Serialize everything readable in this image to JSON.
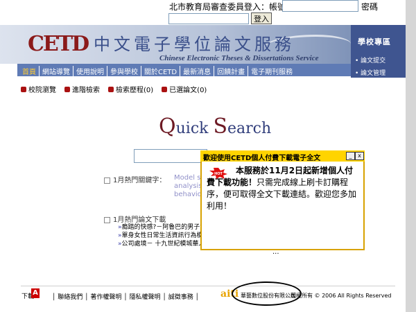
{
  "login": {
    "label": "北市教育局審查委員登入：帳號",
    "password_label": "密碼",
    "account_value": "",
    "password_value": "",
    "button": "登入"
  },
  "banner": {
    "logo": "CETD",
    "title_cn": "中文電子學位論文服務",
    "title_en": "Chinese Electronic Theses & Dissertations Service"
  },
  "school_zone": {
    "title": "學校專區",
    "links": [
      "• 論文提交",
      "• 論文管理"
    ]
  },
  "nav": {
    "items": [
      "首頁",
      "網站導覽",
      "使用說明",
      "參與學校",
      "關於CETD",
      "最新消息",
      "回饋計畫",
      "電子期刊服務"
    ]
  },
  "toolbar": {
    "items": [
      "校院瀏覽",
      "進階檢索",
      "檢索歷程(0)",
      "已選論文(0)"
    ]
  },
  "quick_search": {
    "logo_q": "Q",
    "logo_uick": "uick ",
    "logo_s": "S",
    "logo_earch": "earch",
    "input_value": ""
  },
  "hot_keywords": {
    "label": "1月熱門關鍵字：",
    "lines": [
      "Model  sys",
      "analysis",
      "behavior"
    ]
  },
  "hot_downloads": {
    "label": "1月熱門論文下載",
    "items": [
      "瘾踏的快感?－阿魯巴的男子氣",
      "單身女性日常生活資訊行為模式",
      "公司處境－ 十九世紀模城華人　公司"
    ],
    "more": "..."
  },
  "popup": {
    "title": "歡迎使用CETD個人付費下載電子全文",
    "badge": "HOT",
    "body_bold": "本服務於11月2日起新增個人付費下載功能！",
    "body_rest": "只需完成線上刷卡訂購程序，便可取得全文下載連結。歡迎您多加利用！",
    "min_icon": "_",
    "close_icon": "x"
  },
  "footer": {
    "adobe_label": "下載",
    "links": "│ 聯絡我們 │ 著作權聲明 │ 隱私權聲明 │ 誠徵事務 │",
    "aiti": "aiti",
    "company": "華藝數位股份有限公司",
    "copyright": "版權所有 © 2006 All Rights Reserved"
  }
}
